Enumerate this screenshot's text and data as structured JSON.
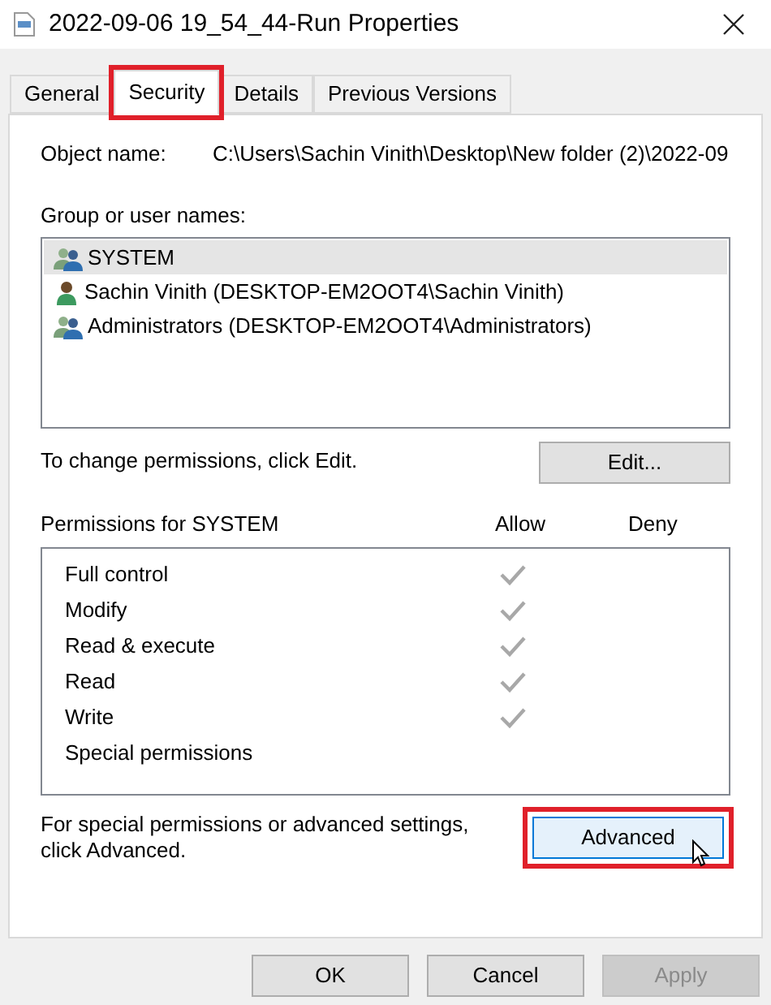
{
  "window": {
    "title": "2022-09-06 19_54_44-Run Properties"
  },
  "tabs": [
    {
      "label": "General",
      "selected": false,
      "highlighted": false
    },
    {
      "label": "Security",
      "selected": true,
      "highlighted": true
    },
    {
      "label": "Details",
      "selected": false,
      "highlighted": false
    },
    {
      "label": "Previous Versions",
      "selected": false,
      "highlighted": false
    }
  ],
  "object_name": {
    "label": "Object name:",
    "value": "C:\\Users\\Sachin Vinith\\Desktop\\New folder (2)\\2022-09"
  },
  "groups": {
    "label": "Group or user names:",
    "items": [
      {
        "name": "SYSTEM",
        "kind": "group",
        "selected": true
      },
      {
        "name": "Sachin Vinith (DESKTOP-EM2OOT4\\Sachin Vinith)",
        "kind": "user",
        "selected": false
      },
      {
        "name": "Administrators (DESKTOP-EM2OOT4\\Administrators)",
        "kind": "group",
        "selected": false
      }
    ]
  },
  "edit_hint": "To change permissions, click Edit.",
  "edit_button": "Edit...",
  "permissions": {
    "label": "Permissions for SYSTEM",
    "allow_label": "Allow",
    "deny_label": "Deny",
    "rows": [
      {
        "name": "Full control",
        "allow": true,
        "deny": false
      },
      {
        "name": "Modify",
        "allow": true,
        "deny": false
      },
      {
        "name": "Read & execute",
        "allow": true,
        "deny": false
      },
      {
        "name": "Read",
        "allow": true,
        "deny": false
      },
      {
        "name": "Write",
        "allow": true,
        "deny": false
      },
      {
        "name": "Special permissions",
        "allow": false,
        "deny": false
      }
    ]
  },
  "advanced_hint": "For special permissions or advanced settings, click Advanced.",
  "advanced_button": {
    "label": "Advanced",
    "highlighted": true
  },
  "buttons": [
    {
      "label": "OK",
      "disabled": false
    },
    {
      "label": "Cancel",
      "disabled": false
    },
    {
      "label": "Apply",
      "disabled": true
    }
  ]
}
